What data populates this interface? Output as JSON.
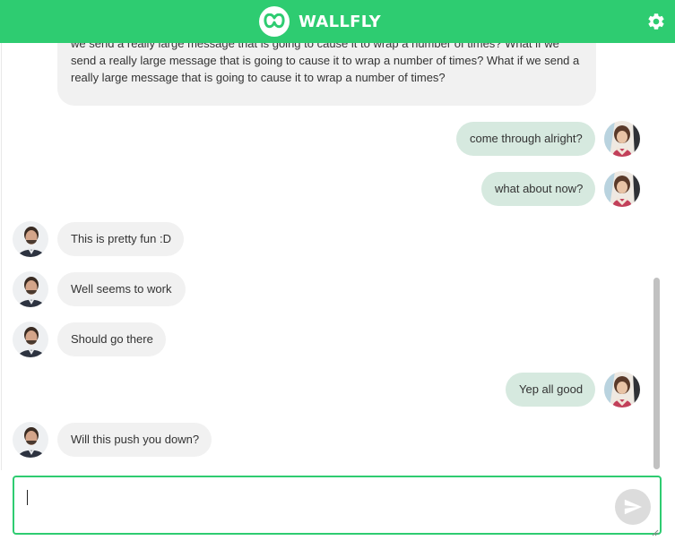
{
  "app": {
    "brand_name": "WALLFLY",
    "logo_icon": "wallfly-logo-icon",
    "settings_icon": "gear-icon",
    "accent_color": "#2ecc71"
  },
  "messages": [
    {
      "from": "other",
      "partial": true,
      "lines": [
        "we send a really large message that is going to cause it to wrap a number of times? What if we",
        "send a really large message that is going to cause it to wrap a number of times? What if we send a",
        "really large message that is going to cause it to wrap a number of times?"
      ]
    },
    {
      "from": "me",
      "text": "come through alright?"
    },
    {
      "from": "me",
      "text": "what about now?"
    },
    {
      "from": "other",
      "text": "This is pretty fun :D"
    },
    {
      "from": "other",
      "text": "Well seems to work"
    },
    {
      "from": "other",
      "text": "Should go there"
    },
    {
      "from": "me",
      "text": "Yep all good"
    },
    {
      "from": "other",
      "text": "Will this push you down?"
    }
  ],
  "composer": {
    "value": "",
    "placeholder": "",
    "send_icon": "send-icon"
  },
  "colors": {
    "incoming_bubble": "#f1f1f1",
    "outgoing_bubble": "#d6e9df"
  }
}
